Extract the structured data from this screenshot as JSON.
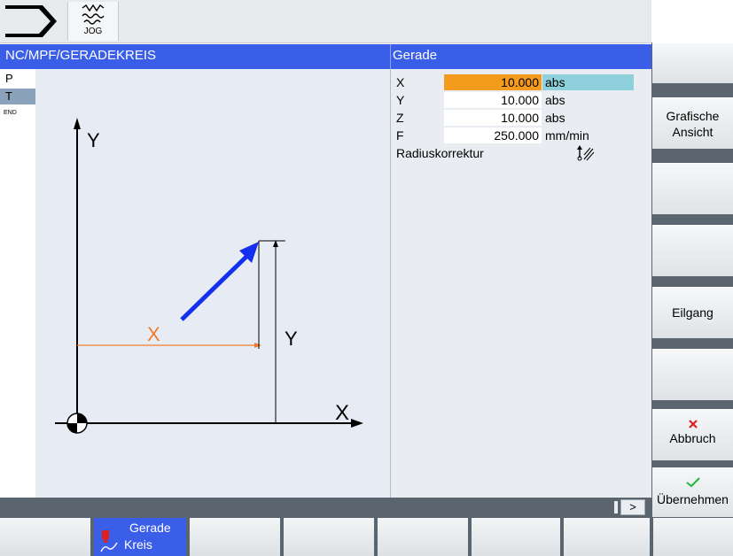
{
  "top": {
    "mode_label": "JOG"
  },
  "header": {
    "path": "NC/MPF/GERADEKREIS",
    "panel_title": "Gerade"
  },
  "left_strip": {
    "items": [
      "P",
      "T",
      "END"
    ]
  },
  "diagram": {
    "y_axis": "Y",
    "x_axis": "X",
    "dim_x": "X",
    "dim_y": "Y"
  },
  "params": [
    {
      "name": "X",
      "value": "10.000",
      "unit": "abs"
    },
    {
      "name": "Y",
      "value": "10.000",
      "unit": "abs"
    },
    {
      "name": "Z",
      "value": "10.000",
      "unit": "abs"
    },
    {
      "name": "F",
      "value": "250.000",
      "unit": "mm/min"
    }
  ],
  "radius": {
    "label": "Radiuskorrektur"
  },
  "status": {
    "more": ">"
  },
  "softkeys": {
    "grafische_1": "Grafische",
    "grafische_2": "Ansicht",
    "eilgang": "Eilgang",
    "abbruch": "Abbruch",
    "uebernehmen": "Übernehmen"
  },
  "bottom": {
    "gerade": "Gerade",
    "kreis": "Kreis"
  },
  "colors": {
    "header": "#3b5ee8",
    "field_active": "#f49a1c",
    "unit_active": "#8fd0dd"
  }
}
